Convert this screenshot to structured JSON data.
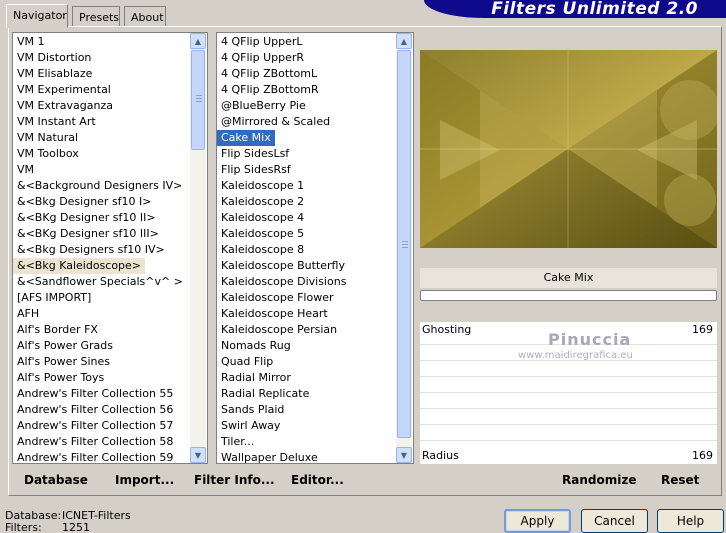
{
  "banner": {
    "title": "Filters Unlimited 2.0"
  },
  "tabs": [
    {
      "label": "Navigator"
    },
    {
      "label": "Presets"
    },
    {
      "label": "About"
    }
  ],
  "categories": [
    "VM 1",
    "VM Distortion",
    "VM Elisablaze",
    "VM Experimental",
    "VM Extravaganza",
    "VM Instant Art",
    "VM Natural",
    "VM Toolbox",
    "VM",
    "&<Background Designers IV>",
    "&<Bkg Designer sf10 I>",
    "&<BKg Designer sf10 II>",
    "&<BKg Designer sf10 III>",
    "&<Bkg Designers sf10 IV>",
    "&<Bkg Kaleidoscope>",
    "&<Sandflower Specials^v^ >",
    "[AFS IMPORT]",
    "AFH",
    "Alf's Border FX",
    "Alf's Power Grads",
    "Alf's Power Sines",
    "Alf's Power Toys",
    "Andrew's Filter Collection 55",
    "Andrew's Filter Collection 56",
    "Andrew's Filter Collection 57",
    "Andrew's Filter Collection 58",
    "Andrew's Filter Collection 59"
  ],
  "categories_highlighted_index": 14,
  "filters": [
    "4 QFlip UpperL",
    "4 QFlip UpperR",
    "4 QFlip ZBottomL",
    "4 QFlip ZBottomR",
    "@BlueBerry Pie",
    "@Mirrored & Scaled",
    "Cake Mix",
    "Flip SidesLsf",
    "Flip SidesRsf",
    "Kaleidoscope 1",
    "Kaleidoscope 2",
    "Kaleidoscope 4",
    "Kaleidoscope 5",
    "Kaleidoscope 8",
    "Kaleidoscope Butterfly",
    "Kaleidoscope Divisions",
    "Kaleidoscope Flower",
    "Kaleidoscope Heart",
    "Kaleidoscope Persian",
    "Nomads Rug",
    "Quad Flip",
    "Radial Mirror",
    "Radial Replicate",
    "Sands Plaid",
    "Swirl Away",
    "Tiler...",
    "Wallpaper Deluxe"
  ],
  "filters_selected_index": 6,
  "preview": {
    "filter_name": "Cake Mix"
  },
  "sliders": [
    {
      "label": "Ghosting",
      "value": "169"
    },
    {
      "label": "Radius",
      "value": "169"
    }
  ],
  "watermark": {
    "line1": "Pinuccia",
    "line2": "www.maidiregrafica.eu"
  },
  "toolbar": {
    "database": "Database",
    "import": "Import...",
    "filter_info": "Filter Info...",
    "editor": "Editor...",
    "randomize": "Randomize",
    "reset": "Reset"
  },
  "status": {
    "database_label": "Database:",
    "database_value": "ICNET-Filters",
    "filters_label": "Filters:",
    "filters_value": "1251"
  },
  "buttons": {
    "apply": "Apply",
    "cancel": "Cancel",
    "help": "Help"
  },
  "colors": {
    "selection": "#316ac5",
    "banner": "#0f0a8c",
    "preview_base": "#8a7a20"
  }
}
